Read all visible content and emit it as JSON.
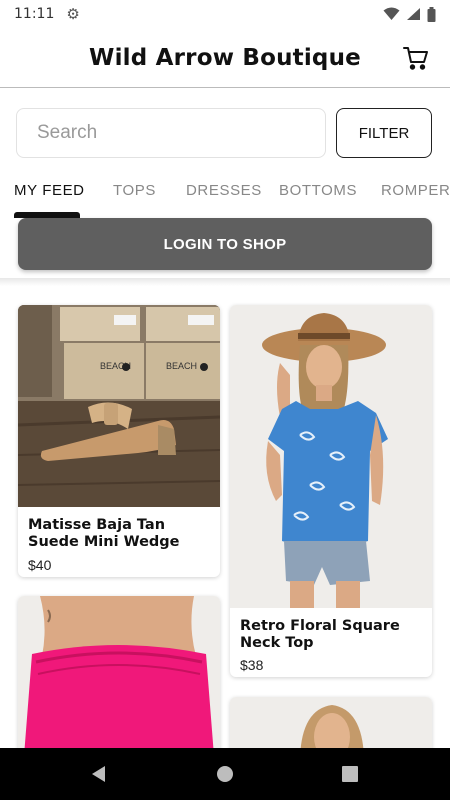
{
  "status_bar": {
    "time": "11:11"
  },
  "header": {
    "title": "Wild Arrow Boutique"
  },
  "search": {
    "placeholder": "Search",
    "value": ""
  },
  "filter_label": "FILTER",
  "tabs": [
    {
      "label": "MY FEED",
      "active": true
    },
    {
      "label": "TOPS"
    },
    {
      "label": "DRESSES"
    },
    {
      "label": "BOTTOMS"
    },
    {
      "label": "ROMPERS"
    }
  ],
  "login_label": "LOGIN TO SHOP",
  "products": [
    {
      "title": "Matisse Baja Tan Suede Mini Wedge",
      "price": "$40"
    },
    {
      "title": "Retro Floral Square Neck Top",
      "price": "$38"
    }
  ],
  "colors": {
    "login_button": "#5f5f5f",
    "active_tab": "#111111",
    "inactive_tab": "#888888",
    "nav_bar": "#000000"
  },
  "icons": [
    "gear-icon",
    "wifi-icon",
    "signal-icon",
    "battery-icon",
    "cart-icon",
    "back-icon",
    "home-icon",
    "recents-icon"
  ]
}
